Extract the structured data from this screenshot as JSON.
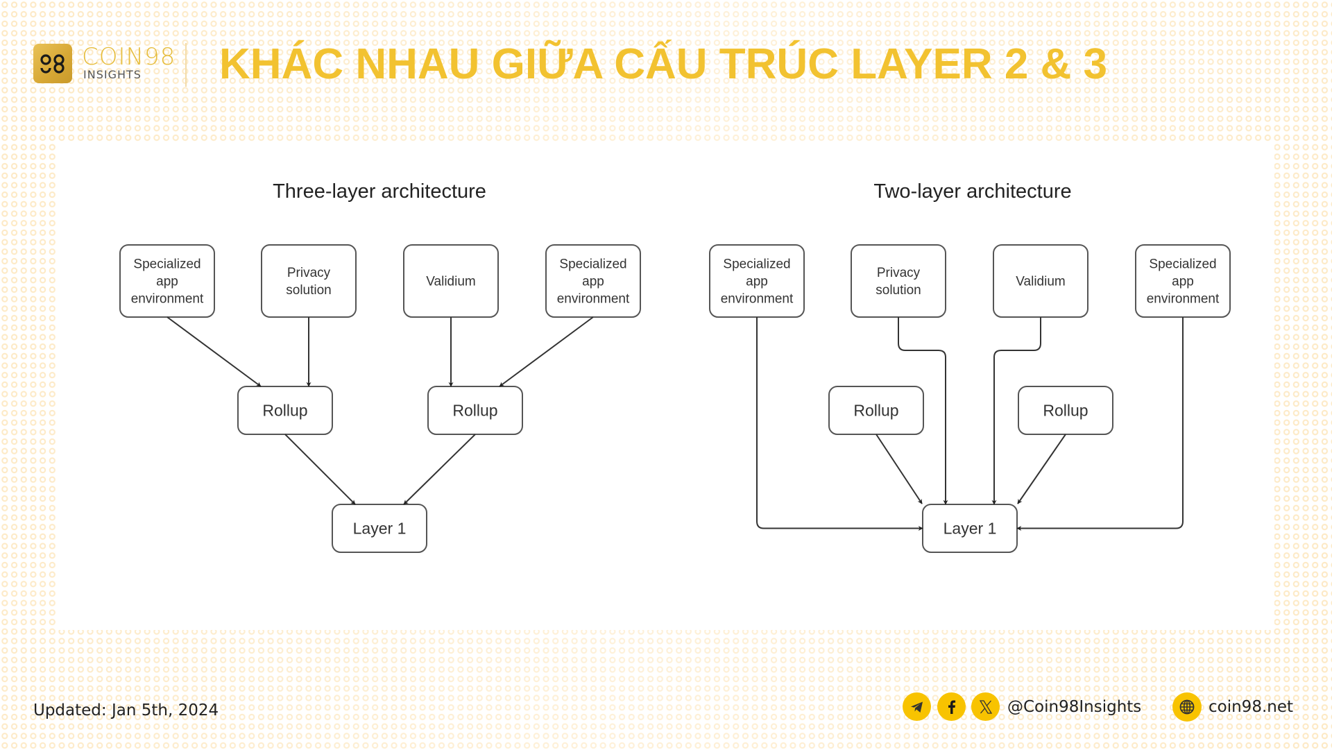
{
  "header": {
    "brand_name": "COIN98",
    "brand_sub": "INSIGHTS",
    "logo_glyph": "98",
    "title": "KHÁC NHAU GIỮA CẤU TRÚC LAYER 2 & 3"
  },
  "colors": {
    "title": "#F2C230",
    "social_icon_bg": "#F8C300",
    "node_stroke": "#555555",
    "edge": "#333333"
  },
  "diagrams": [
    {
      "title": "Three-layer architecture",
      "top_nodes": [
        {
          "lines": [
            "Specialized",
            "app",
            "environment"
          ]
        },
        {
          "lines": [
            "Privacy",
            "solution"
          ]
        },
        {
          "lines": [
            "Validium"
          ]
        },
        {
          "lines": [
            "Specialized",
            "app",
            "environment"
          ]
        }
      ],
      "middle_nodes": [
        {
          "label": "Rollup"
        },
        {
          "label": "Rollup"
        }
      ],
      "base_node": {
        "label": "Layer 1"
      },
      "edges": [
        {
          "from": "Specialized app environment (1)",
          "to": "Rollup (1)"
        },
        {
          "from": "Privacy solution",
          "to": "Rollup (1)"
        },
        {
          "from": "Validium",
          "to": "Rollup (2)"
        },
        {
          "from": "Specialized app environment (2)",
          "to": "Rollup (2)"
        },
        {
          "from": "Rollup (1)",
          "to": "Layer 1"
        },
        {
          "from": "Rollup (2)",
          "to": "Layer 1"
        }
      ]
    },
    {
      "title": "Two-layer architecture",
      "top_nodes": [
        {
          "lines": [
            "Specialized",
            "app",
            "environment"
          ]
        },
        {
          "lines": [
            "Privacy",
            "solution"
          ]
        },
        {
          "lines": [
            "Validium"
          ]
        },
        {
          "lines": [
            "Specialized",
            "app",
            "environment"
          ]
        }
      ],
      "middle_nodes": [
        {
          "label": "Rollup"
        },
        {
          "label": "Rollup"
        }
      ],
      "base_node": {
        "label": "Layer 1"
      },
      "edges": [
        {
          "from": "Specialized app environment (1)",
          "to": "Layer 1"
        },
        {
          "from": "Privacy solution",
          "to": "Layer 1"
        },
        {
          "from": "Validium",
          "to": "Layer 1"
        },
        {
          "from": "Specialized app environment (2)",
          "to": "Layer 1"
        },
        {
          "from": "Rollup (1)",
          "to": "Layer 1"
        },
        {
          "from": "Rollup (2)",
          "to": "Layer 1"
        }
      ]
    }
  ],
  "footer": {
    "updated": "Updated: Jan 5th, 2024",
    "social_icons": [
      "telegram-icon",
      "facebook-icon",
      "x-icon"
    ],
    "handle": "@Coin98Insights",
    "website_icon": "globe-icon",
    "website": "coin98.net"
  }
}
